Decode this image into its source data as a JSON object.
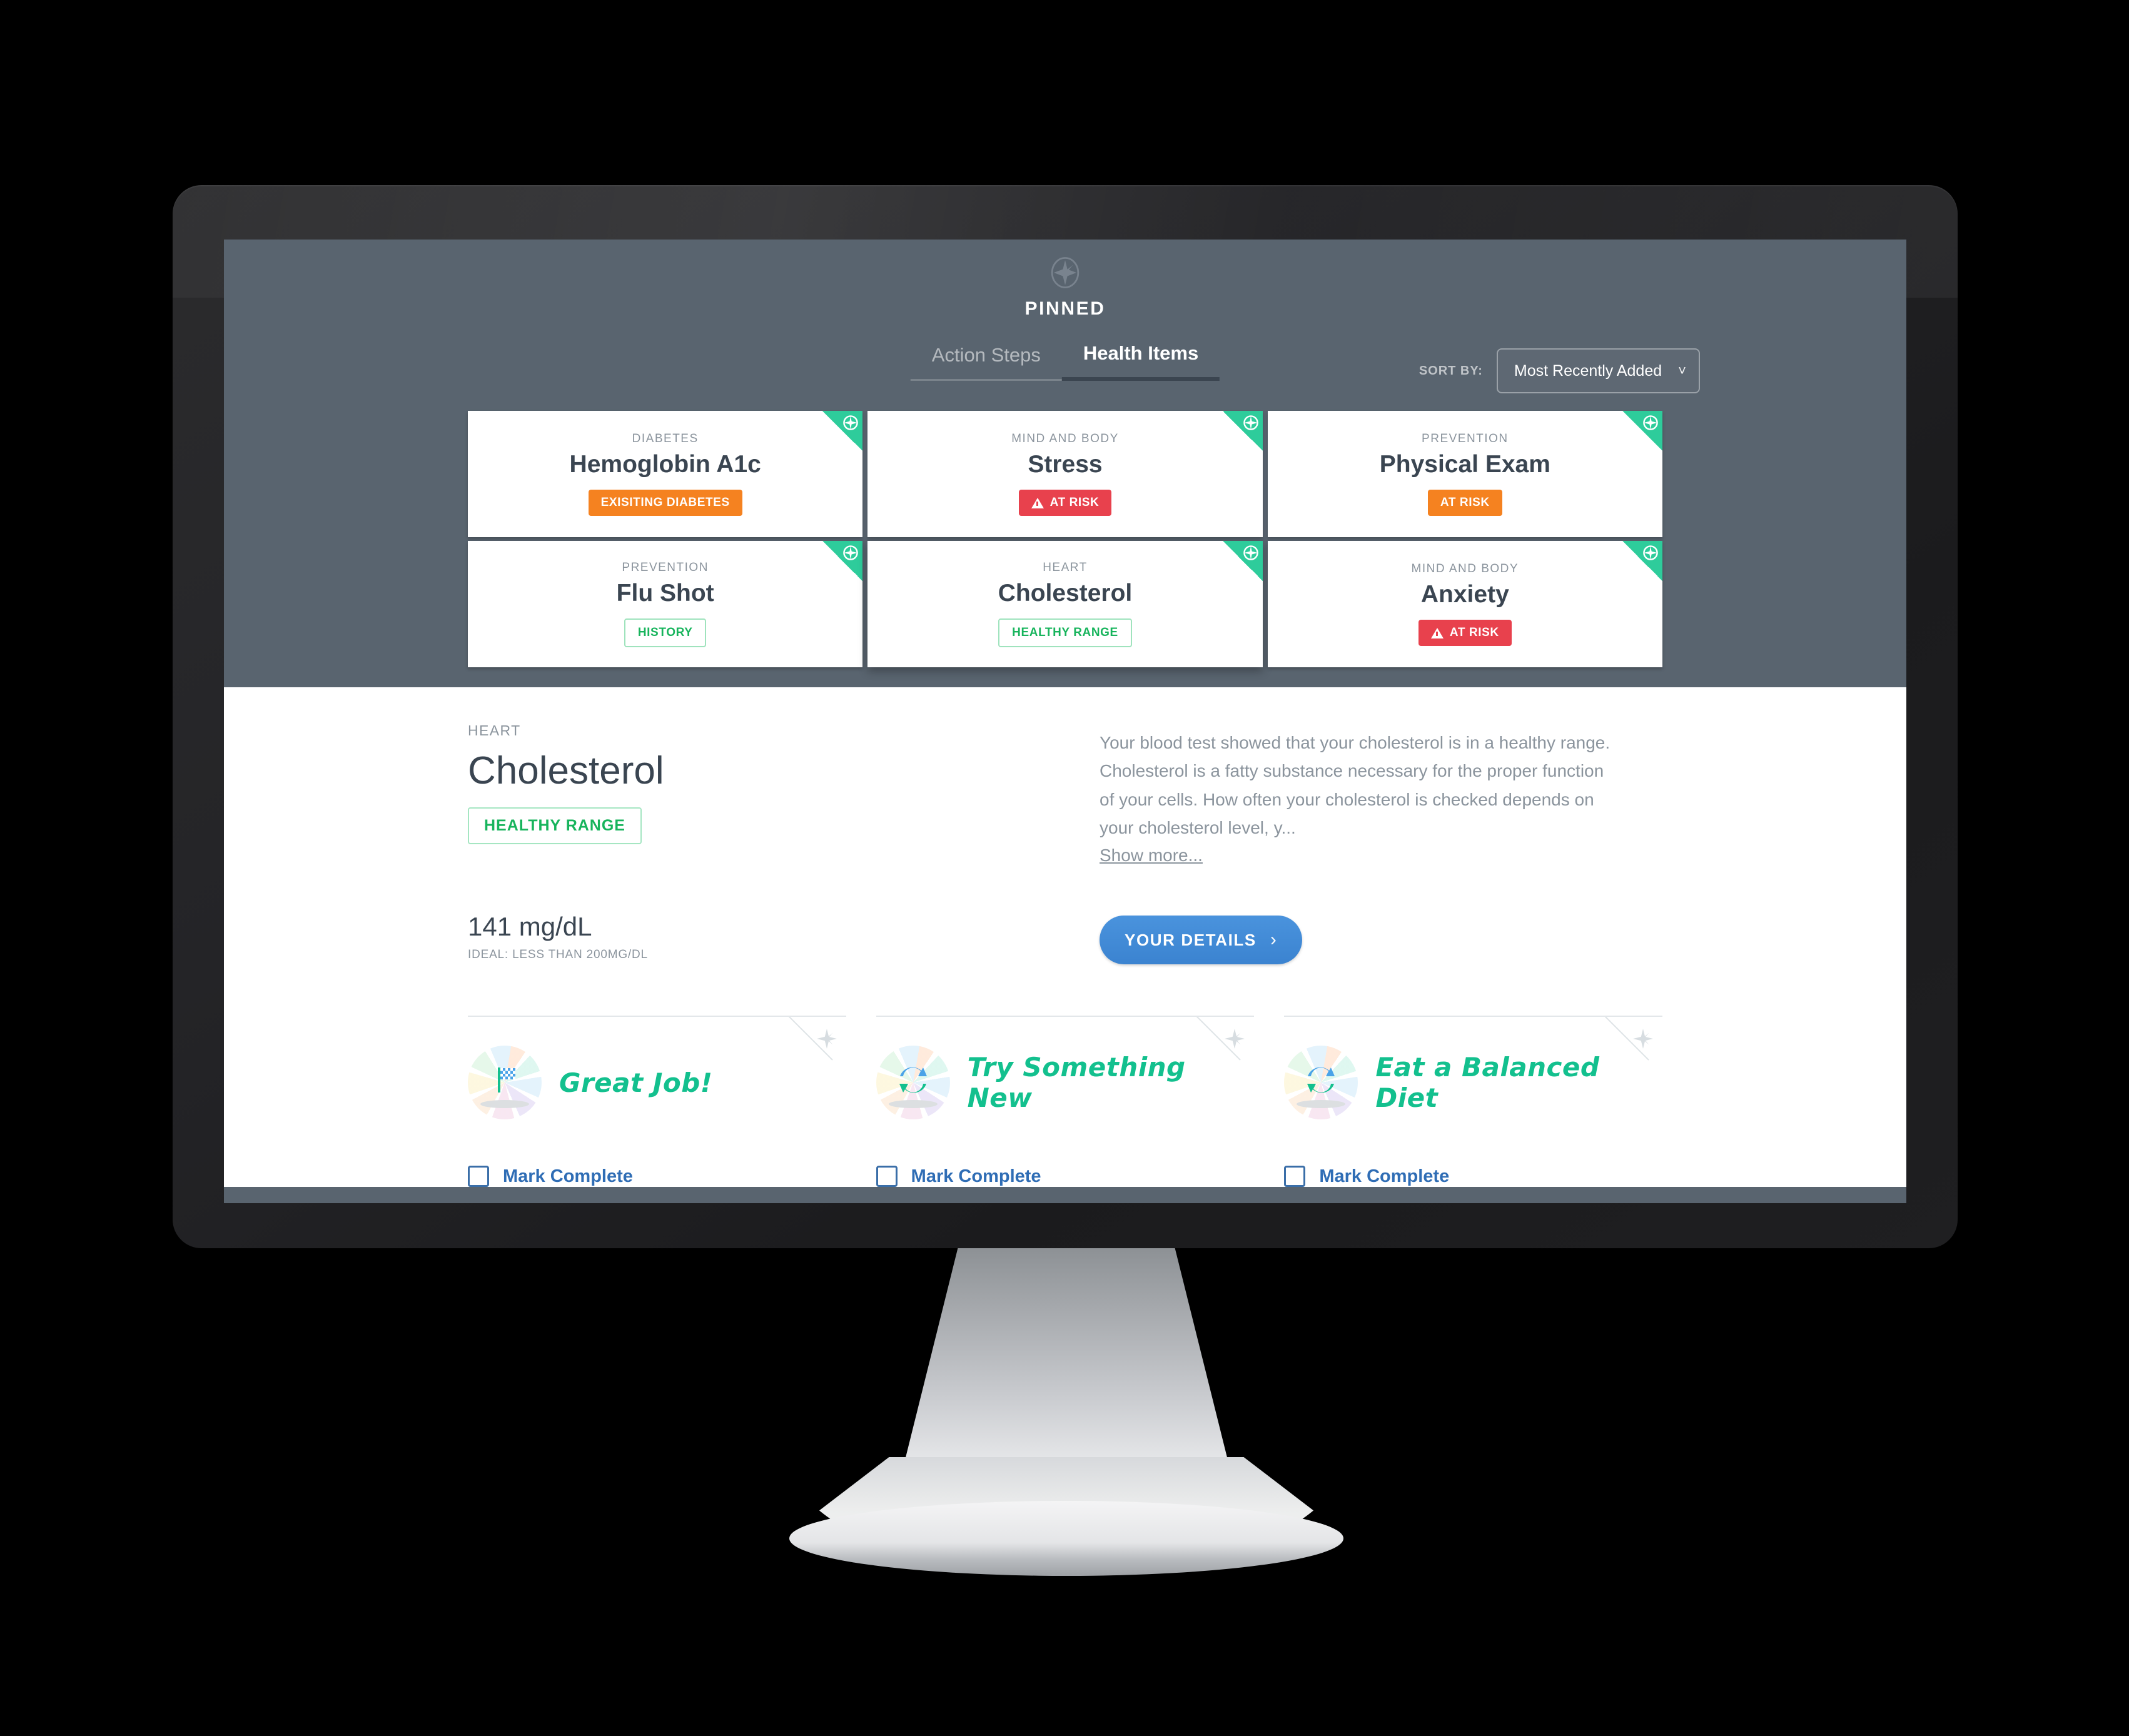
{
  "app": {
    "logo_icon": "compass-star-icon",
    "title": "PINNED"
  },
  "tabs": [
    {
      "label": "Action Steps",
      "active": false
    },
    {
      "label": "Health Items",
      "active": true
    }
  ],
  "sort": {
    "label": "SORT BY:",
    "value": "Most Recently Added",
    "chevron": "˅"
  },
  "colors": {
    "screen_bg": "#59646f",
    "pin_teal": "#2ecc9b",
    "badge_orange": "#f58220",
    "badge_red": "#e8414d",
    "badge_green": "#17b45c",
    "cta_blue": "#3b83d0",
    "action_green": "#13c08e",
    "link_blue": "#2f6db5",
    "heading_slate": "#3a4551",
    "muted_gray": "#8b949d"
  },
  "health_items": [
    {
      "category": "DIABETES",
      "name": "Hemoglobin A1c",
      "badge": "EXISITING DIABETES",
      "badge_style": "orange",
      "warn_icon": false,
      "pinned": true,
      "selected": false
    },
    {
      "category": "MIND AND BODY",
      "name": "Stress",
      "badge": "AT RISK",
      "badge_style": "red",
      "warn_icon": true,
      "pinned": true,
      "selected": false
    },
    {
      "category": "PREVENTION",
      "name": "Physical Exam",
      "badge": "AT RISK",
      "badge_style": "orange",
      "warn_icon": false,
      "pinned": true,
      "selected": false
    },
    {
      "category": "PREVENTION",
      "name": "Flu Shot",
      "badge": "HISTORY",
      "badge_style": "green-outline",
      "warn_icon": false,
      "pinned": true,
      "selected": false
    },
    {
      "category": "HEART",
      "name": "Cholesterol",
      "badge": "HEALTHY RANGE",
      "badge_style": "green-outline",
      "warn_icon": false,
      "pinned": true,
      "selected": true
    },
    {
      "category": "MIND AND BODY",
      "name": "Anxiety",
      "badge": "AT RISK",
      "badge_style": "red",
      "warn_icon": true,
      "pinned": true,
      "selected": false
    }
  ],
  "detail": {
    "category": "HEART",
    "title": "Cholesterol",
    "status_badge": "HEALTHY RANGE",
    "description": "Your blood test showed that your cholesterol is in a healthy range. Cholesterol is a fatty substance necessary for the proper function of your cells. How often your cholesterol is checked depends on your cholesterol level, y...",
    "show_more": "Show more...",
    "measurement": "141 mg/dL",
    "ideal": "IDEAL: LESS THAN 200MG/DL",
    "details_button": "YOUR DETAILS",
    "details_chevron": "›"
  },
  "action_steps": [
    {
      "label": "Great Job!",
      "icon": "checkered-flag-icon",
      "checkbox_label": "Mark Complete",
      "checked": false
    },
    {
      "label": "Try Something New",
      "icon": "refresh-cycle-icon",
      "checkbox_label": "Mark Complete",
      "checked": false
    },
    {
      "label": "Eat a Balanced Diet",
      "icon": "refresh-cycle-icon",
      "checkbox_label": "Mark Complete",
      "checked": false
    }
  ]
}
